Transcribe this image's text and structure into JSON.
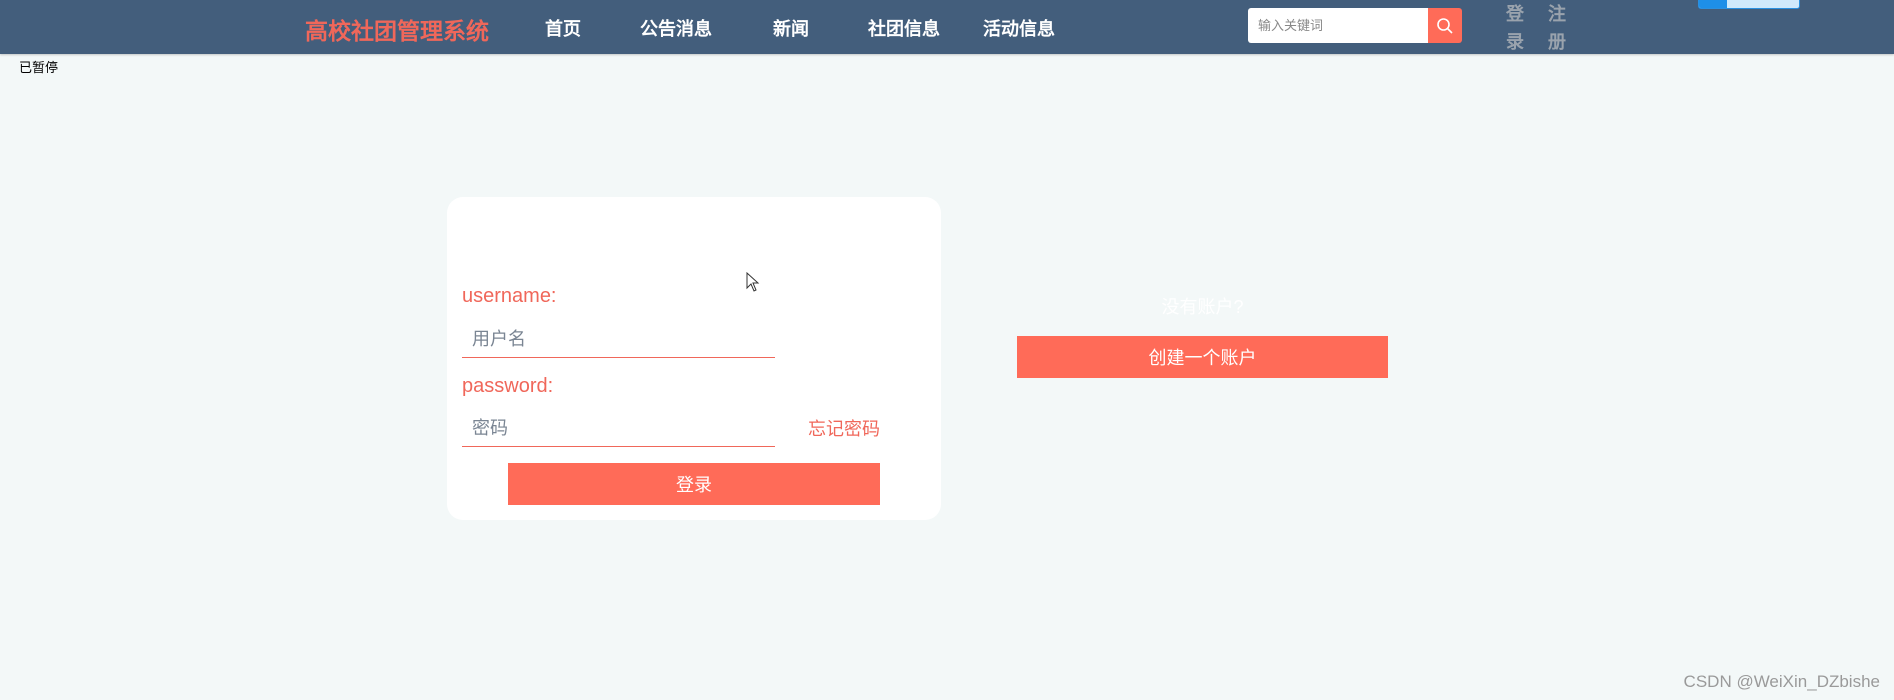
{
  "header": {
    "brand": "高校社团管理系统",
    "nav": [
      "首页",
      "公告消息",
      "新闻",
      "社团信息",
      "活动信息"
    ],
    "search_placeholder": "输入关键词",
    "search_icon": "search-icon",
    "login_label": [
      "登",
      "录"
    ],
    "register_label": [
      "注",
      "册"
    ]
  },
  "status_text": "已暂停",
  "login_form": {
    "username_label": "username:",
    "username_placeholder": "用户名",
    "password_label": "password:",
    "password_placeholder": "密码",
    "forgot_password": "忘记密码",
    "login_button": "登录"
  },
  "signup": {
    "prompt": "没有账户?",
    "create_button": "创建一个账户"
  },
  "watermark": "CSDN @WeiXin_DZbishe",
  "colors": {
    "header_bg": "#435e7c",
    "accent": "#ff6b58",
    "brand": "#f0675a",
    "page_bg": "#f3f8f8"
  }
}
